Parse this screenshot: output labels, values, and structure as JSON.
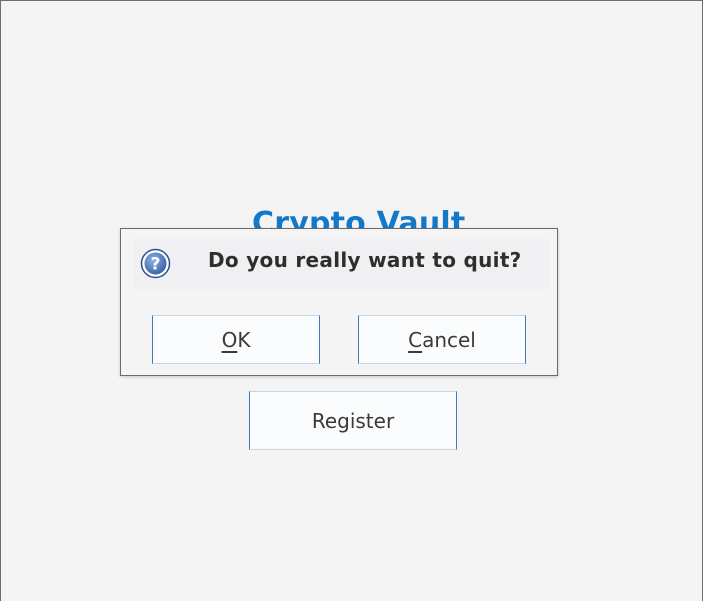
{
  "app": {
    "title": "Crypto Vault",
    "accent_color": "#1478c8",
    "register_label": "Register"
  },
  "dialog": {
    "icon": "question-icon",
    "message": "Do you really want to quit?",
    "ok_mnemonic": "O",
    "ok_rest": "K",
    "cancel_mnemonic": "C",
    "cancel_rest": "ancel"
  }
}
